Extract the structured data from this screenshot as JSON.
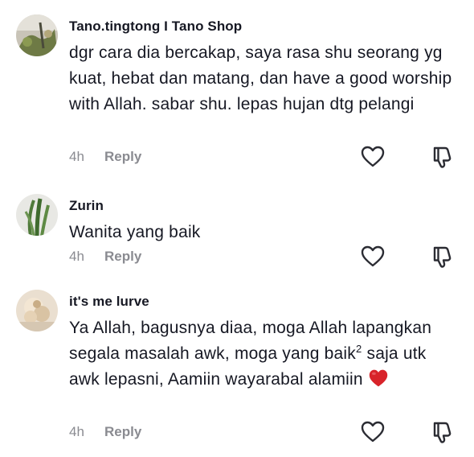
{
  "comments": [
    {
      "username": "Tano.tingtong I Tano Shop",
      "text": "dgr cara dia bercakap, saya rasa shu seorang yg kuat, hebat dan matang, dan have a good worship with Allah. sabar shu. lepas hujan dtg pelangi",
      "time": "4h",
      "reply_label": "Reply"
    },
    {
      "username": "Zurin",
      "text": "Wanita yang baik",
      "time": "4h",
      "reply_label": "Reply"
    },
    {
      "username": "it's me lurve",
      "text_before": "Ya Allah, bagusnya diaa, moga Allah lapangkan segala masalah awk, moga yang baik",
      "text_sup": "2",
      "text_after": " saja utk awk lepasni, Aamiin wayarabal alamiin",
      "emoji": "red-heart-emoji",
      "time": "4h",
      "reply_label": "Reply"
    }
  ],
  "colors": {
    "text": "#161823",
    "secondary": "#8a8b91",
    "heart_emoji": "#d8232a"
  },
  "icons": {
    "like": "heart-outline-icon",
    "dislike": "thumbs-down-outline-icon"
  }
}
